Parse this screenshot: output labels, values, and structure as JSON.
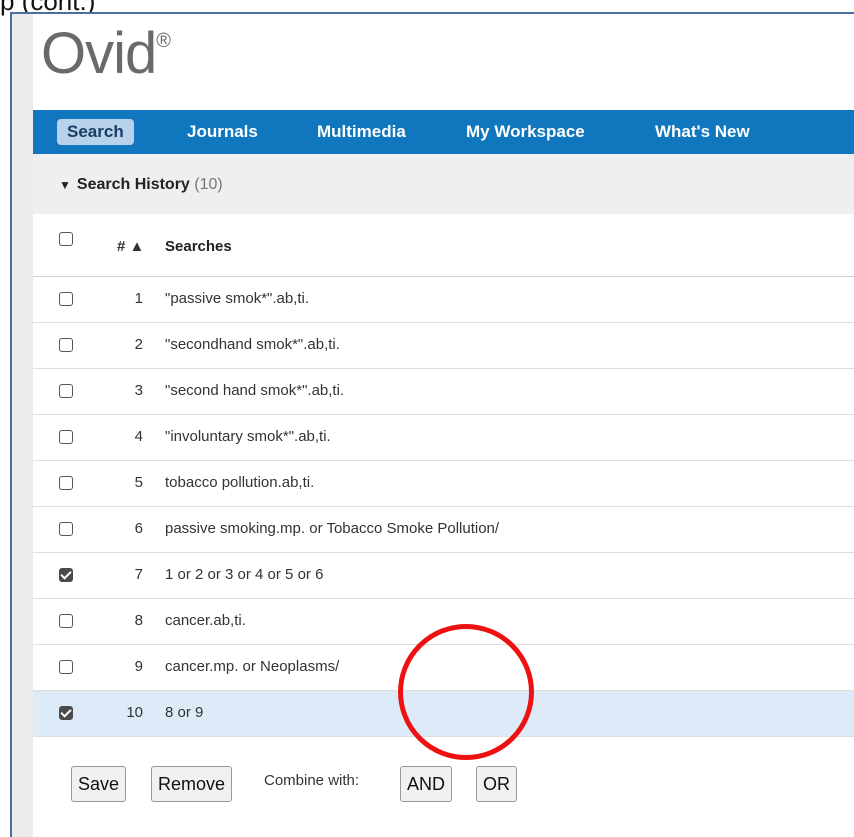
{
  "caption": "p (cont.)",
  "logo": {
    "text": "Ovid",
    "mark": "®"
  },
  "nav": {
    "items": [
      {
        "label": "Search",
        "active": true
      },
      {
        "label": "Journals"
      },
      {
        "label": "Multimedia"
      },
      {
        "label": "My Workspace"
      },
      {
        "label": "What's New"
      }
    ]
  },
  "history": {
    "title": "Search History",
    "count": "(10)",
    "columns": {
      "number": "# ▲",
      "searches": "Searches"
    },
    "rows": [
      {
        "num": "1",
        "query": "\"passive smok*\".ab,ti.",
        "checked": false
      },
      {
        "num": "2",
        "query": "\"secondhand smok*\".ab,ti.",
        "checked": false
      },
      {
        "num": "3",
        "query": "\"second hand smok*\".ab,ti.",
        "checked": false
      },
      {
        "num": "4",
        "query": "\"involuntary smok*\".ab,ti.",
        "checked": false
      },
      {
        "num": "5",
        "query": "tobacco pollution.ab,ti.",
        "checked": false
      },
      {
        "num": "6",
        "query": "passive smoking.mp. or Tobacco Smoke Pollution/",
        "checked": false
      },
      {
        "num": "7",
        "query": "1 or 2 or 3 or 4 or 5 or 6",
        "checked": true
      },
      {
        "num": "8",
        "query": "cancer.ab,ti.",
        "checked": false
      },
      {
        "num": "9",
        "query": "cancer.mp. or Neoplasms/",
        "checked": false
      },
      {
        "num": "10",
        "query": "8 or 9",
        "checked": true
      }
    ]
  },
  "actions": {
    "save": "Save",
    "remove": "Remove",
    "combine_label": "Combine with:",
    "and": "AND",
    "or": "OR"
  },
  "colors": {
    "nav_bg": "#1077be",
    "highlight_row": "#dcebf7",
    "annotation": "#ee1111"
  }
}
